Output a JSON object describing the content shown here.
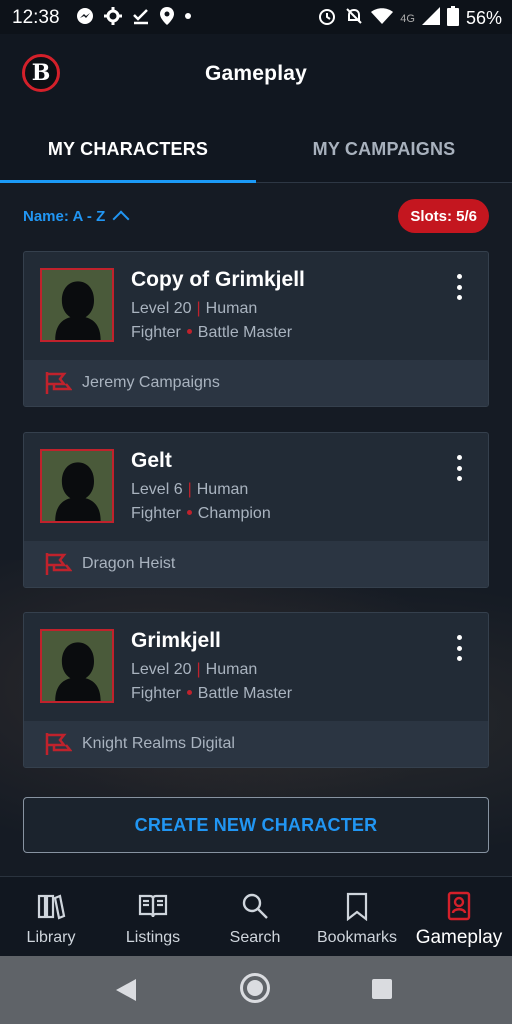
{
  "status_bar": {
    "time": "12:38",
    "left_icons": [
      "messenger-icon",
      "settings-icon",
      "done-icon",
      "location-icon",
      "dot-icon"
    ],
    "network_label": "4G",
    "battery_percent": "56%"
  },
  "header": {
    "title": "Gameplay",
    "logo_letter": "B"
  },
  "tabs": [
    {
      "label": "MY CHARACTERS",
      "active": true
    },
    {
      "label": "MY CAMPAIGNS",
      "active": false
    }
  ],
  "sort": {
    "label": "Name: A - Z"
  },
  "slots": {
    "label": "Slots: 5/6"
  },
  "characters": [
    {
      "name": "Copy of Grimkjell",
      "level": "Level 20",
      "race": "Human",
      "class": "Fighter",
      "subclass": "Battle Master",
      "campaign": "Jeremy Campaigns"
    },
    {
      "name": "Gelt",
      "level": "Level 6",
      "race": "Human",
      "class": "Fighter",
      "subclass": "Champion",
      "campaign": "Dragon Heist"
    },
    {
      "name": "Grimkjell",
      "level": "Level 20",
      "race": "Human",
      "class": "Fighter",
      "subclass": "Battle Master",
      "campaign": "Knight Realms Digital"
    }
  ],
  "create_button": {
    "label": "CREATE NEW CHARACTER"
  },
  "bottom_nav": [
    {
      "label": "Library",
      "icon": "library-icon"
    },
    {
      "label": "Listings",
      "icon": "book-open-icon"
    },
    {
      "label": "Search",
      "icon": "search-icon"
    },
    {
      "label": "Bookmarks",
      "icon": "bookmark-icon"
    },
    {
      "label": "Gameplay",
      "icon": "gameplay-icon",
      "active": true
    }
  ],
  "colors": {
    "accent_blue": "#2196f3",
    "accent_red": "#c4161f",
    "background": "#151b24",
    "card": "#222b36"
  }
}
